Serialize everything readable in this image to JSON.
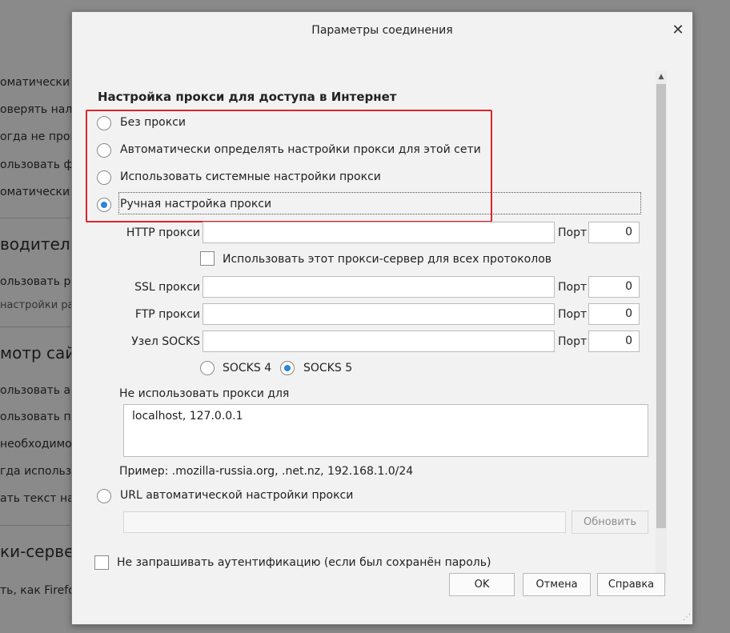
{
  "background": {
    "lines": [
      "оматически у",
      "оверять нали",
      "огда не пров",
      "ользовать фо",
      "оматически с"
    ],
    "heading1": "водитель",
    "lines2": [
      "ользовать ре"
    ],
    "small1": "настройки рас",
    "heading2": "мотр сайто",
    "lines3": [
      "ользовать ав",
      "ользовать пл",
      " необходимо",
      "гда использо",
      "ать текст на с"
    ],
    "heading3": "ки-сервер",
    "lines4": [
      "ть, как Firefo"
    ]
  },
  "dialog": {
    "title": "Параметры соединения",
    "close_icon": "close-icon",
    "section_title": "Настройка прокси для доступа в Интернет",
    "options": [
      {
        "label": "Без прокси",
        "checked": false
      },
      {
        "label": "Автоматически определять настройки прокси для этой сети",
        "checked": false
      },
      {
        "label": "Использовать системные настройки прокси",
        "checked": false
      },
      {
        "label": "Ручная настройка прокси",
        "checked": true
      }
    ],
    "http": {
      "label": "HTTP прокси",
      "value": "",
      "port_label": "Порт",
      "port": "0"
    },
    "use_for_all": {
      "label": "Использовать этот прокси-сервер для всех протоколов",
      "checked": false
    },
    "ssl": {
      "label": "SSL прокси",
      "value": "",
      "port_label": "Порт",
      "port": "0"
    },
    "ftp": {
      "label": "FTP прокси",
      "value": "",
      "port_label": "Порт",
      "port": "0"
    },
    "socks": {
      "label": "Узел SOCKS",
      "value": "",
      "port_label": "Порт",
      "port": "0"
    },
    "socks4": {
      "label": "SOCKS 4",
      "checked": false
    },
    "socks5": {
      "label": "SOCKS 5",
      "checked": true
    },
    "no_proxy": {
      "label": "Не использовать прокси для",
      "value": "localhost, 127.0.0.1"
    },
    "example": "Пример: .mozilla-russia.org, .net.nz, 192.168.1.0/24",
    "auto_url": {
      "label": "URL автоматической настройки прокси",
      "value": "",
      "reload": "Обновить",
      "checked": false
    },
    "no_auth": {
      "label": "Не запрашивать аутентификацию (если был сохранён пароль)",
      "checked": false
    },
    "buttons": {
      "ok": "OK",
      "cancel": "Отмена",
      "help": "Справка"
    }
  },
  "colors": {
    "accent": "#2d86d6",
    "highlight": "#d9262b",
    "dialog_bg": "#f2f2f2",
    "backdrop": "#8a8a8a"
  }
}
